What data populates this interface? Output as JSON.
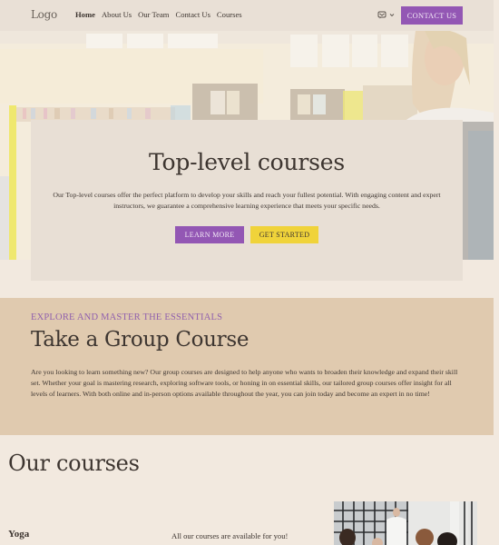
{
  "header": {
    "logo": "Logo",
    "nav": [
      "Home",
      "About Us",
      "Our Team",
      "Contact Us",
      "Courses"
    ],
    "language_icon": "language-icon",
    "contact_button": "CONTACT US"
  },
  "hero": {
    "title": "Top-level courses",
    "text": "Our Top-level courses offer the perfect platform to develop your skills and reach your fullest potential. With engaging content and expert instructors, we guarantee a comprehensive learning experience that meets your specific needs.",
    "learn_more": "LEARN MORE",
    "get_started": "GET STARTED"
  },
  "group": {
    "eyebrow": "EXPLORE AND MASTER THE ESSENTIALS",
    "title": "Take a Group Course",
    "text": "Are you looking to learn something new? Our group courses are designed to help anyone who wants to broaden their knowledge and expand their skill set. Whether your goal is mastering research, exploring software tools, or honing in on essential skills, our tailored group courses offer insight for all levels of learners. With both online and in-person options available throughout the year, you can join today and become an expert in no time!"
  },
  "courses": {
    "title": "Our courses",
    "items": [
      {
        "name": "Yoga"
      }
    ],
    "note": "All our courses are available for you!"
  },
  "colors": {
    "accent_purple": "#9357b4",
    "accent_yellow": "#f0d33a",
    "section_tan": "#e0caaf",
    "page_bg": "#f2e9df"
  }
}
